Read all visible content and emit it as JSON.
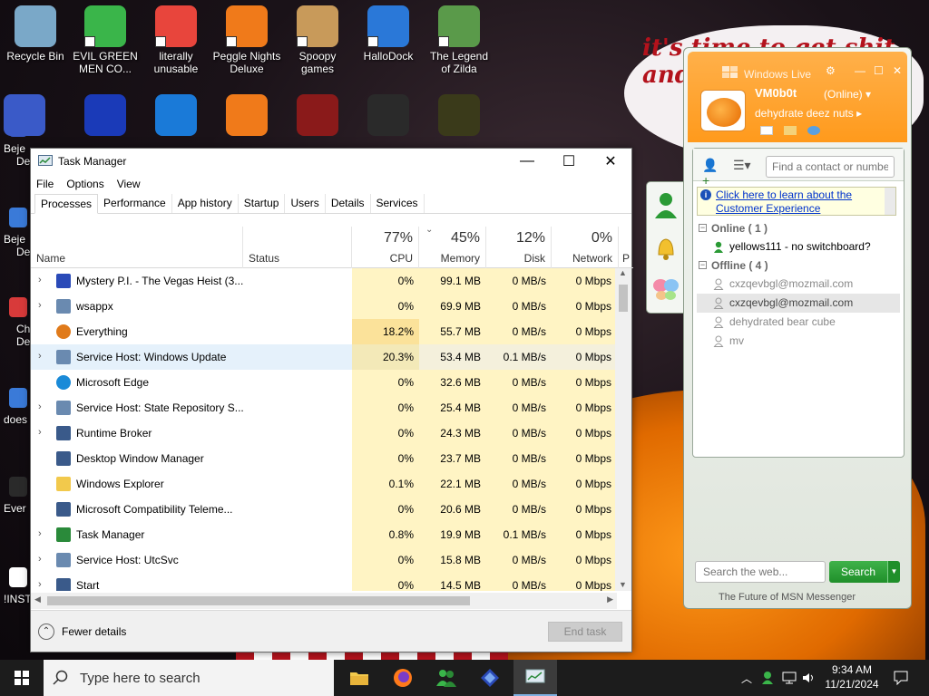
{
  "desktop": {
    "icons_row1": [
      {
        "label": "Recycle Bin",
        "icon": "recycle-bin-icon"
      },
      {
        "label": "EVIL GREEN MEN CO...",
        "icon": "msn-buddies-icon"
      },
      {
        "label": "literally unusable",
        "icon": "chrome-icon"
      },
      {
        "label": "Peggle Nights Deluxe",
        "icon": "peggle-icon"
      },
      {
        "label": "Spoopy games",
        "icon": "folder-icon"
      },
      {
        "label": "HalloDock",
        "icon": "windows-logo-icon"
      },
      {
        "label": "The Legend of Zilda",
        "icon": "zelda-icon"
      }
    ],
    "left_edge_labels": [
      "Beje",
      "De",
      "Beje",
      "De",
      "Ch",
      "De",
      "does",
      "Ever",
      "!INST"
    ],
    "wallpaper_text": "it's time to get shit and or t"
  },
  "task_manager": {
    "title": "Task Manager",
    "menu": [
      "File",
      "Options",
      "View"
    ],
    "tabs": [
      "Processes",
      "Performance",
      "App history",
      "Startup",
      "Users",
      "Details",
      "Services"
    ],
    "columns": {
      "name": "Name",
      "status": "Status",
      "cpu": {
        "pct": "77%",
        "label": "CPU"
      },
      "memory": {
        "pct": "45%",
        "label": "Memory"
      },
      "disk": {
        "pct": "12%",
        "label": "Disk"
      },
      "network": {
        "pct": "0%",
        "label": "Network"
      },
      "power": {
        "label": "P"
      }
    },
    "rows": [
      {
        "name": "Mystery P.I. - The Vegas Heist (3...",
        "expand": true,
        "cpu": "0%",
        "memory": "99.1 MB",
        "disk": "0 MB/s",
        "network": "0 Mbps",
        "icon": "mystery-pi-icon"
      },
      {
        "name": "wsappx",
        "expand": true,
        "cpu": "0%",
        "memory": "69.9 MB",
        "disk": "0 MB/s",
        "network": "0 Mbps",
        "icon": "gear-icon"
      },
      {
        "name": "Everything",
        "expand": false,
        "cpu": "18.2%",
        "memory": "55.7 MB",
        "disk": "0 MB/s",
        "network": "0 Mbps",
        "icon": "magnifier-icon"
      },
      {
        "name": "Service Host: Windows Update",
        "expand": true,
        "cpu": "20.3%",
        "memory": "53.4 MB",
        "disk": "0.1 MB/s",
        "network": "0 Mbps",
        "icon": "gear-icon",
        "selected": true
      },
      {
        "name": "Microsoft Edge",
        "expand": false,
        "cpu": "0%",
        "memory": "32.6 MB",
        "disk": "0 MB/s",
        "network": "0 Mbps",
        "icon": "edge-icon"
      },
      {
        "name": "Service Host: State Repository S...",
        "expand": true,
        "cpu": "0%",
        "memory": "25.4 MB",
        "disk": "0 MB/s",
        "network": "0 Mbps",
        "icon": "gear-icon"
      },
      {
        "name": "Runtime Broker",
        "expand": true,
        "cpu": "0%",
        "memory": "24.3 MB",
        "disk": "0 MB/s",
        "network": "0 Mbps",
        "icon": "window-icon"
      },
      {
        "name": "Desktop Window Manager",
        "expand": false,
        "cpu": "0%",
        "memory": "23.7 MB",
        "disk": "0 MB/s",
        "network": "0 Mbps",
        "icon": "window-icon"
      },
      {
        "name": "Windows Explorer",
        "expand": false,
        "cpu": "0.1%",
        "memory": "22.1 MB",
        "disk": "0 MB/s",
        "network": "0 Mbps",
        "icon": "folder-icon"
      },
      {
        "name": "Microsoft Compatibility Teleme...",
        "expand": false,
        "cpu": "0%",
        "memory": "20.6 MB",
        "disk": "0 MB/s",
        "network": "0 Mbps",
        "icon": "window-icon"
      },
      {
        "name": "Task Manager",
        "expand": true,
        "cpu": "0.8%",
        "memory": "19.9 MB",
        "disk": "0.1 MB/s",
        "network": "0 Mbps",
        "icon": "task-manager-icon"
      },
      {
        "name": "Service Host: UtcSvc",
        "expand": true,
        "cpu": "0%",
        "memory": "15.8 MB",
        "disk": "0 MB/s",
        "network": "0 Mbps",
        "icon": "gear-icon"
      },
      {
        "name": "Start",
        "expand": true,
        "cpu": "0%",
        "memory": "14.5 MB",
        "disk": "0 MB/s",
        "network": "0 Mbps",
        "icon": "window-icon"
      }
    ],
    "fewer_details": "Fewer details",
    "end_task": "End task"
  },
  "messenger": {
    "window_title": "Windows Live",
    "username": "VM0b0t",
    "status": "(Online)",
    "personal_message": "dehydrate deez nuts",
    "find_placeholder": "Find a contact or numbe",
    "banner": "Click here to learn about the Customer Experience",
    "groups": [
      {
        "label": "Online ( 1 )",
        "contacts": [
          {
            "name": "yellows111 - no switchboard?",
            "online": true
          }
        ]
      },
      {
        "label": "Offline ( 4 )",
        "contacts": [
          {
            "name": "cxzqevbgl@mozmail.com",
            "online": false
          },
          {
            "name": "cxzqevbgl@mozmail.com",
            "online": false,
            "selected": true
          },
          {
            "name": "dehydrated bear cube",
            "online": false
          },
          {
            "name": "mv",
            "online": false
          }
        ]
      }
    ],
    "web_search_placeholder": "Search the web...",
    "search_button": "Search",
    "footer": "The Future of MSN Messenger"
  },
  "taskbar": {
    "search_placeholder": "Type here to search",
    "time": "9:34 AM",
    "date": "11/21/2024"
  },
  "colors": {
    "tm_cpu_hot": "#fbe29a",
    "tm_cell_light": "#fff4c4",
    "wlm_orange": "#ff9a1c",
    "wlm_green": "#2a9a35",
    "taskbar": "#1c1c1c"
  }
}
